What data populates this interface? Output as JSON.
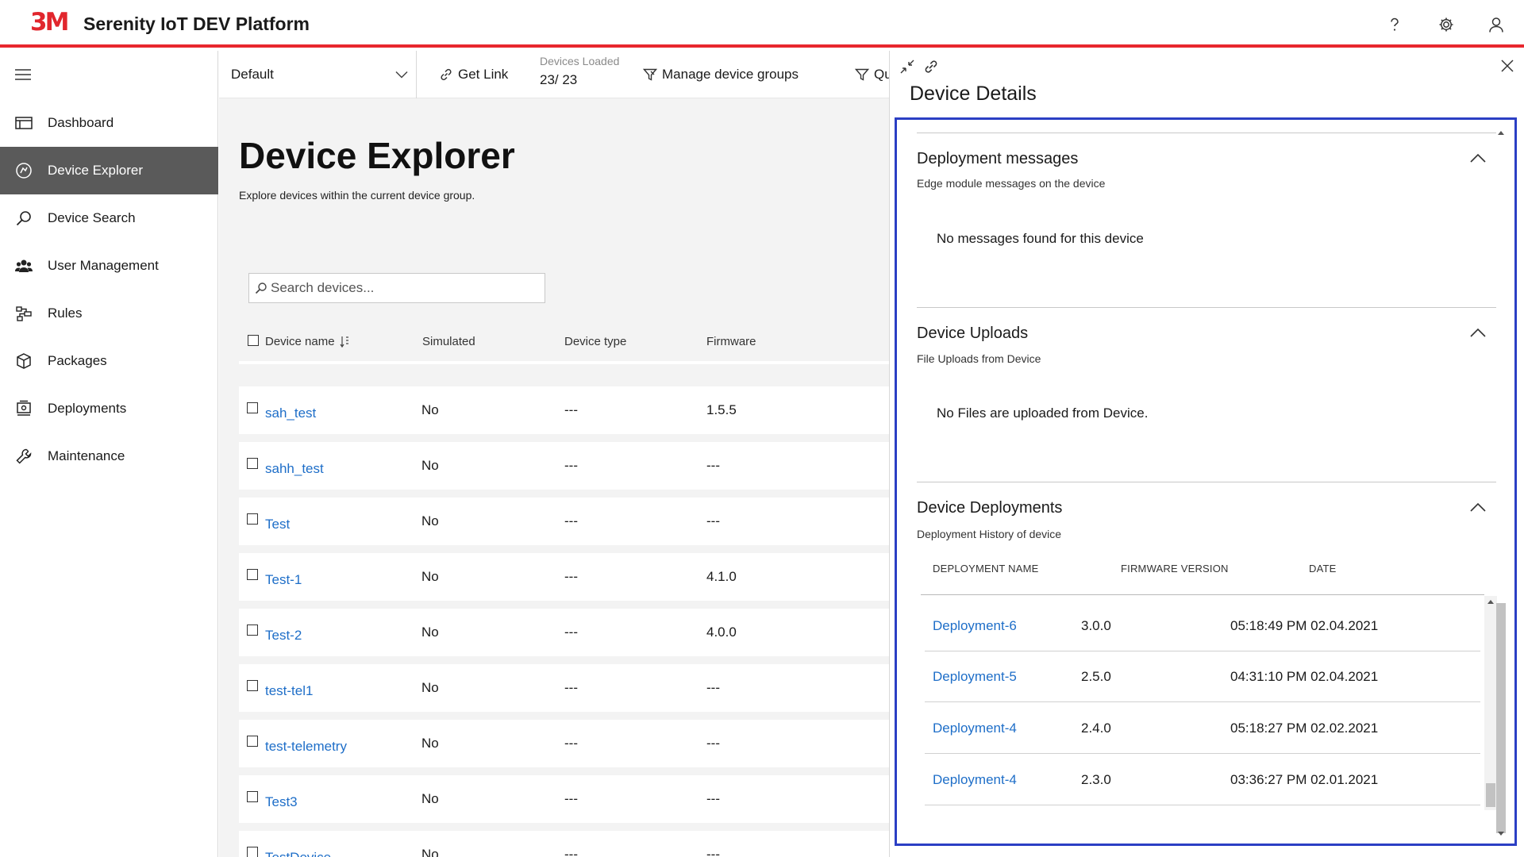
{
  "header": {
    "logo_text": "3M",
    "app_title": "Serenity IoT DEV Platform",
    "icons": [
      "help-icon",
      "gear-icon",
      "user-icon"
    ],
    "accent_color": "#e8282e"
  },
  "sidebar": {
    "items": [
      {
        "label": "Dashboard",
        "icon": "dashboard-icon",
        "active": false
      },
      {
        "label": "Device Explorer",
        "icon": "device-explorer-icon",
        "active": true
      },
      {
        "label": "Device Search",
        "icon": "search-icon",
        "active": false
      },
      {
        "label": "User Management",
        "icon": "users-icon",
        "active": false
      },
      {
        "label": "Rules",
        "icon": "rules-icon",
        "active": false
      },
      {
        "label": "Packages",
        "icon": "package-icon",
        "active": false
      },
      {
        "label": "Deployments",
        "icon": "deployments-icon",
        "active": false
      },
      {
        "label": "Maintenance",
        "icon": "wrench-icon",
        "active": false
      }
    ]
  },
  "toolbar": {
    "device_group": "Default",
    "get_link": "Get Link",
    "devices_loaded_label": "Devices Loaded",
    "devices_loaded_value": "23/ 23",
    "manage_groups": "Manage device groups",
    "query_partial": "Qu"
  },
  "main": {
    "title": "Device Explorer",
    "subtitle": "Explore devices within the current device group.",
    "search_placeholder": "Search devices...",
    "columns": {
      "name": "Device name",
      "simulated": "Simulated",
      "device_type": "Device type",
      "firmware": "Firmware"
    },
    "rows": [
      {
        "name": "sah_test",
        "simulated": "No",
        "type": "---",
        "firmware": "1.5.5"
      },
      {
        "name": "sahh_test",
        "simulated": "No",
        "type": "---",
        "firmware": "---"
      },
      {
        "name": "Test",
        "simulated": "No",
        "type": "---",
        "firmware": "---"
      },
      {
        "name": "Test-1",
        "simulated": "No",
        "type": "---",
        "firmware": "4.1.0"
      },
      {
        "name": "Test-2",
        "simulated": "No",
        "type": "---",
        "firmware": "4.0.0"
      },
      {
        "name": "test-tel1",
        "simulated": "No",
        "type": "---",
        "firmware": "---"
      },
      {
        "name": "test-telemetry",
        "simulated": "No",
        "type": "---",
        "firmware": "---"
      },
      {
        "name": "Test3",
        "simulated": "No",
        "type": "---",
        "firmware": "---"
      },
      {
        "name": "TestDevice",
        "simulated": "No",
        "type": "---",
        "firmware": "---"
      }
    ]
  },
  "panel": {
    "title": "Device Details",
    "highlight_color": "#2b3fc4",
    "sections": {
      "messages": {
        "title": "Deployment messages",
        "subtitle": "Edge module messages on the device",
        "empty": "No messages found for this device"
      },
      "uploads": {
        "title": "Device Uploads",
        "subtitle": "File Uploads from Device",
        "empty": "No Files are uploaded from Device."
      },
      "deployments": {
        "title": "Device Deployments",
        "subtitle": "Deployment History of device",
        "col_name": "DEPLOYMENT NAME",
        "col_version": "FIRMWARE VERSION",
        "col_date": "DATE",
        "rows": [
          {
            "name": "Deployment-6",
            "version": "3.0.0",
            "date": "05:18:49 PM 02.04.2021"
          },
          {
            "name": "Deployment-5",
            "version": "2.5.0",
            "date": "04:31:10 PM 02.04.2021"
          },
          {
            "name": "Deployment-4",
            "version": "2.4.0",
            "date": "05:18:27 PM 02.02.2021"
          },
          {
            "name": "Deployment-4",
            "version": "2.3.0",
            "date": "03:36:27 PM 02.01.2021"
          }
        ]
      }
    }
  }
}
